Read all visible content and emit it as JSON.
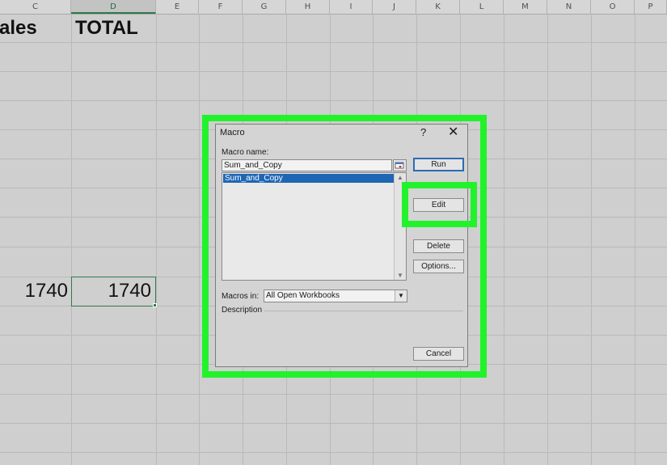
{
  "spreadsheet": {
    "columns": [
      "C",
      "D",
      "E",
      "F",
      "G",
      "H",
      "I",
      "J",
      "K",
      "L",
      "M",
      "N",
      "O",
      "P"
    ],
    "selected_column": "D",
    "cells": {
      "c_header": "ales",
      "d_header": "TOTAL",
      "c_value": "1740",
      "d_value": "1740"
    }
  },
  "dialog": {
    "title": "Macro",
    "help_label": "?",
    "close_label": "✕",
    "macro_name_label": "Macro name:",
    "macro_name_value": "Sum_and_Copy",
    "list_items": [
      "Sum_and_Copy"
    ],
    "buttons": {
      "run": "Run",
      "edit": "Edit",
      "delete": "Delete",
      "options": "Options...",
      "cancel": "Cancel"
    },
    "macros_in_label": "Macros in:",
    "macros_in_value": "All Open Workbooks",
    "description_label": "Description"
  },
  "colors": {
    "highlight": "#22f22b",
    "selection_blue": "#1f66b5",
    "excel_green": "#2f7a4c"
  }
}
